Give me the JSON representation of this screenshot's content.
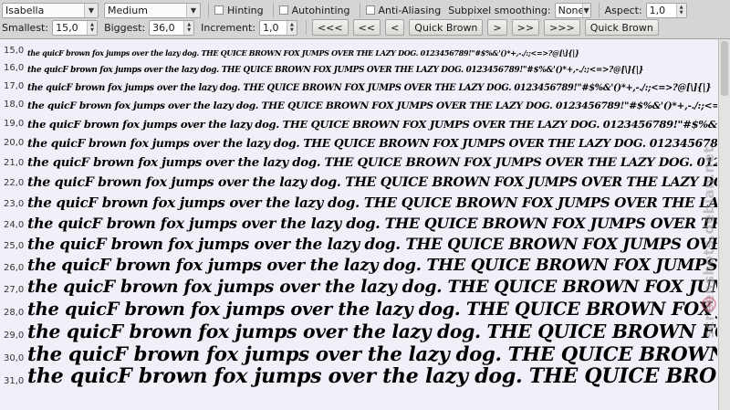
{
  "toolbar": {
    "font_family": "Isabella",
    "font_style": "Medium",
    "hinting_label": "Hinting",
    "autohinting_label": "Autohinting",
    "antialiasing_label": "Anti-Aliasing",
    "subpixel_label": "Subpixel smoothing:",
    "subpixel_value": "None",
    "aspect_label": "Aspect:",
    "aspect_value": "1,0",
    "smallest_label": "Smallest:",
    "smallest_value": "15,0",
    "biggest_label": "Biggest:",
    "biggest_value": "36,0",
    "increment_label": "Increment:",
    "increment_value": "1,0",
    "btn_first": "<<<",
    "btn_prev2": "<<",
    "btn_prev": "<",
    "btn_quick1": "Quick Brown",
    "btn_next": ">",
    "btn_next2": ">>",
    "btn_last": ">>>",
    "btn_quick2": "Quick Brown"
  },
  "sample_text": "the quicF brown fox jumps over the lazy dog. THE QUICE BROWN FOX JUMPS OVER THE LAZY DOG. 0123456789!\"#$%&'()*+,-./:;<=>?@[\\]{|}",
  "rows": [
    {
      "size": "15,0"
    },
    {
      "size": "16,0"
    },
    {
      "size": "17,0"
    },
    {
      "size": "18,0"
    },
    {
      "size": "19,0"
    },
    {
      "size": "20,0"
    },
    {
      "size": "21,0"
    },
    {
      "size": "22,0"
    },
    {
      "size": "23,0"
    },
    {
      "size": "24,0"
    },
    {
      "size": "25,0"
    },
    {
      "size": "26,0"
    },
    {
      "size": "27,0"
    },
    {
      "size": "28,0"
    },
    {
      "size": "29,0"
    },
    {
      "size": "30,0"
    },
    {
      "size": "31,0"
    }
  ],
  "watermark": "screenshots.debian.net"
}
